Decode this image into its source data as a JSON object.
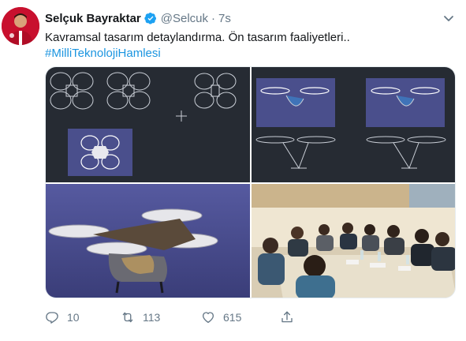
{
  "tweet": {
    "author_name": "Selçuk Bayraktar",
    "handle": "@Selcuk",
    "separator": "·",
    "timestamp": "7s",
    "text": "Kavramsal tasarım detaylandırma. Ön tasarım faaliyetleri..",
    "hashtag": "#MilliTeknolojiHamlesi"
  },
  "actions": {
    "reply_count": "10",
    "retweet_count": "113",
    "like_count": "615"
  },
  "icons": {
    "verified": "verified-badge-icon",
    "caret": "chevron-down-icon",
    "reply": "reply-icon",
    "retweet": "retweet-icon",
    "like": "heart-icon",
    "share": "share-icon"
  },
  "colors": {
    "link": "#1b95e0",
    "muted": "#657786",
    "verified": "#1da1f2",
    "cad_background": "#262b33",
    "render_background": "#4a4f8c"
  }
}
